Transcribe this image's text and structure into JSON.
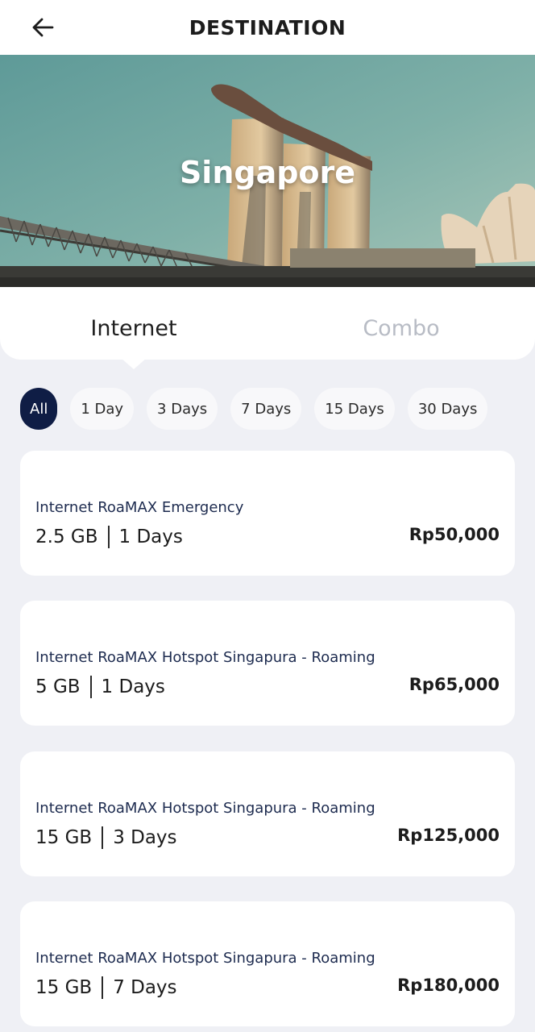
{
  "header": {
    "title": "DESTINATION",
    "back_icon": "arrow-left-icon"
  },
  "hero": {
    "title": "Singapore"
  },
  "tabs": [
    {
      "label": "Internet",
      "active": true
    },
    {
      "label": "Combo",
      "active": false
    }
  ],
  "filters": [
    {
      "label": "All",
      "active": true
    },
    {
      "label": "1 Day",
      "active": false
    },
    {
      "label": "3 Days",
      "active": false
    },
    {
      "label": "7 Days",
      "active": false
    },
    {
      "label": "15 Days",
      "active": false
    },
    {
      "label": "30 Days",
      "active": false
    }
  ],
  "packages": [
    {
      "name": "Internet RoaMAX Emergency",
      "quota": "2.5 GB",
      "duration": "1 Days",
      "price": "Rp50,000"
    },
    {
      "name": "Internet RoaMAX Hotspot Singapura - Roaming",
      "quota": "5 GB",
      "duration": "1 Days",
      "price": "Rp65,000"
    },
    {
      "name": "Internet RoaMAX Hotspot Singapura - Roaming",
      "quota": "15 GB",
      "duration": "3 Days",
      "price": "Rp125,000"
    },
    {
      "name": "Internet RoaMAX Hotspot Singapura - Roaming",
      "quota": "15 GB",
      "duration": "7 Days",
      "price": "Rp180,000"
    }
  ],
  "colors": {
    "accent": "#0f1d45",
    "background": "#eff0f5",
    "inactive_tab": "#b8bcc5"
  }
}
